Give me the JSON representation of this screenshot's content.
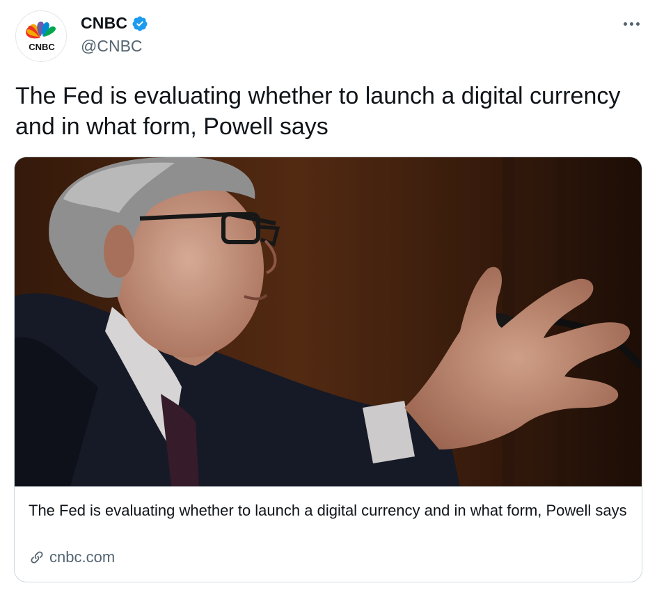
{
  "author": {
    "display_name": "CNBC",
    "handle": "@CNBC",
    "verified": true,
    "avatar_logo_text": "CNBC"
  },
  "tweet": {
    "text": "The Fed is evaluating whether to launch a digital currency and in what form, Powell says"
  },
  "card": {
    "title": "The Fed is evaluating whether to launch a digital currency and in what form, Powell says",
    "domain": "cnbc.com",
    "image_icon": "photo"
  },
  "icons": {
    "verified": "verified-badge-icon",
    "more": "more-horizontal-icon",
    "link": "link-icon"
  },
  "colors": {
    "text_primary": "#0f1419",
    "text_secondary": "#536471",
    "verified_blue": "#1d9bf0",
    "border": "#cfd9de"
  }
}
